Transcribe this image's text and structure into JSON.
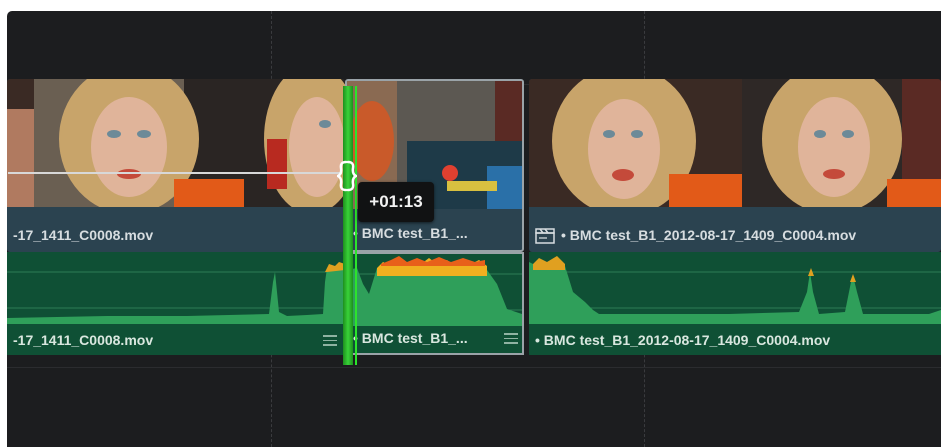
{
  "timeline": {
    "trim_tooltip": "+01:13",
    "video_clips": [
      {
        "label": "-17_1411_C0008.mov",
        "dot": false,
        "icon": "none"
      },
      {
        "label": "• BMC test_B1_...",
        "dot": true,
        "icon": "none"
      },
      {
        "label": "• BMC test_B1_2012-08-17_1409_C0004.mov",
        "dot": true,
        "icon": "clapperboard-icon"
      }
    ],
    "audio_clips": [
      {
        "label": "-17_1411_C0008.mov",
        "icon": "menu-lines-icon"
      },
      {
        "label": "• BMC test_B1_...",
        "icon": "menu-lines-icon"
      },
      {
        "label": "• BMC test_B1_2012-08-17_1409_C0004.mov",
        "icon": "none"
      }
    ],
    "colors": {
      "background": "#1c1d1f",
      "video_clip": "#2b4350",
      "audio_clip": "#0f5035",
      "waveform": "#2f9f5a",
      "waveform_peak": "#f0b020",
      "trim_line": "#39d239",
      "selection_border": "#9aa3a8"
    }
  }
}
